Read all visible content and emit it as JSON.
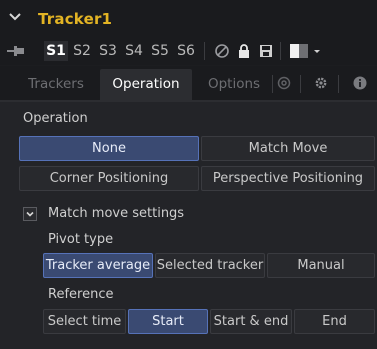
{
  "header": {
    "title": "Tracker1"
  },
  "toolbar": {
    "slots": [
      "S1",
      "S2",
      "S3",
      "S4",
      "S5",
      "S6"
    ],
    "active_slot": "S1"
  },
  "tabs": [
    {
      "label": "Trackers",
      "active": false
    },
    {
      "label": "Operation",
      "active": true
    },
    {
      "label": "Options",
      "active": false
    }
  ],
  "operation": {
    "label": "Operation",
    "buttons": [
      "None",
      "Match Move",
      "Corner Positioning",
      "Perspective Positioning"
    ],
    "selected": "None"
  },
  "match_move": {
    "label": "Match move settings",
    "pivot_type": {
      "label": "Pivot type",
      "options": [
        "Tracker average",
        "Selected tracker",
        "Manual"
      ],
      "selected": "Tracker average"
    },
    "reference": {
      "label": "Reference",
      "options": [
        "Select time",
        "Start",
        "Start & end",
        "End"
      ],
      "selected": "Start"
    }
  },
  "colors": {
    "accent_title": "#e3b424",
    "selected_button": "#3a4a72"
  },
  "icons": [
    "collapse-chevron-icon",
    "pin-icon",
    "no-entry-icon",
    "lock-icon",
    "save-icon",
    "color-swatch-icon",
    "dropdown-arrow-icon",
    "link-icon",
    "gear-icon",
    "info-icon"
  ]
}
